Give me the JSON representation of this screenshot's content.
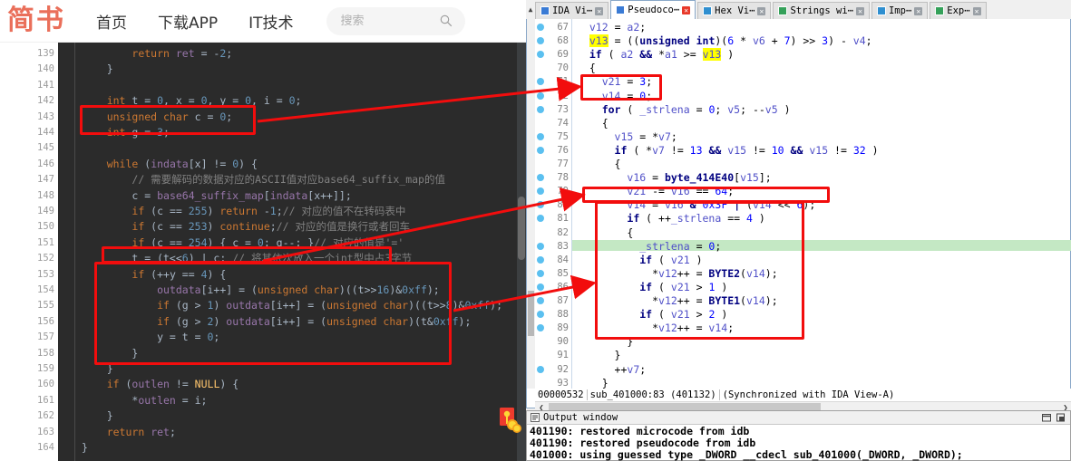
{
  "site": {
    "logo": "简书",
    "nav": [
      "首页",
      "下载APP",
      "IT技术"
    ],
    "search_placeholder": "搜索",
    "search_value": "",
    "search_icon": "search-icon",
    "envelope_icon": "red-envelope-icon"
  },
  "code": {
    "language": "c",
    "first_line": 139,
    "lines": [
      {
        "n": 139,
        "t": "        return ret = -2;"
      },
      {
        "n": 140,
        "t": "    }"
      },
      {
        "n": 141,
        "t": ""
      },
      {
        "n": 142,
        "t": "    int t = 0, x = 0, y = 0, i = 0;"
      },
      {
        "n": 143,
        "t": "    unsigned char c = 0;"
      },
      {
        "n": 144,
        "t": "    int g = 3;"
      },
      {
        "n": 145,
        "t": ""
      },
      {
        "n": 146,
        "t": "    while (indata[x] != 0) {"
      },
      {
        "n": 147,
        "t": "        // 需要解码的数据对应的ASCII值对应base64_suffix_map的值"
      },
      {
        "n": 148,
        "t": "        c = base64_suffix_map[indata[x++]];"
      },
      {
        "n": 149,
        "t": "        if (c == 255) return -1;// 对应的值不在转码表中"
      },
      {
        "n": 150,
        "t": "        if (c == 253) continue;// 对应的值是换行或者回车"
      },
      {
        "n": 151,
        "t": "        if (c == 254) { c = 0; g--; }// 对应的值是'='"
      },
      {
        "n": 152,
        "t": "        t = (t<<6) | c; // 将其依次放入一个int型中占3字节"
      },
      {
        "n": 153,
        "t": "        if (++y == 4) {"
      },
      {
        "n": 154,
        "t": "            outdata[i++] = (unsigned char)((t>>16)&0xff);"
      },
      {
        "n": 155,
        "t": "            if (g > 1) outdata[i++] = (unsigned char)((t>>8)&0xff);"
      },
      {
        "n": 156,
        "t": "            if (g > 2) outdata[i++] = (unsigned char)(t&0xff);"
      },
      {
        "n": 157,
        "t": "            y = t = 0;"
      },
      {
        "n": 158,
        "t": "        }"
      },
      {
        "n": 159,
        "t": "    }"
      },
      {
        "n": 160,
        "t": "    if (outlen != NULL) {"
      },
      {
        "n": 161,
        "t": "        *outlen = i;"
      },
      {
        "n": 162,
        "t": "    }"
      },
      {
        "n": 163,
        "t": "    return ret;"
      },
      {
        "n": 164,
        "t": "}"
      }
    ],
    "highlight_boxes": [
      {
        "name": "decl-box",
        "lines": "143-144"
      },
      {
        "name": "shift-box",
        "line": "152"
      },
      {
        "name": "output-box",
        "lines": "153-158"
      }
    ]
  },
  "ida": {
    "tabs": [
      {
        "label": "IDA Vi⋯",
        "active": false,
        "icon": "ida-view-icon",
        "close": "close-icon"
      },
      {
        "label": "Pseudoco⋯",
        "active": true,
        "icon": "pseudocode-icon",
        "close": "close-icon"
      },
      {
        "label": "Hex Vi⋯",
        "active": false,
        "icon": "hex-view-icon",
        "close": "close-icon"
      },
      {
        "label": "Strings wi⋯",
        "active": false,
        "icon": "strings-icon",
        "close": "close-icon"
      },
      {
        "label": "Imp⋯",
        "active": false,
        "icon": "imports-icon",
        "close": "close-icon"
      },
      {
        "label": "Exp⋯",
        "active": false,
        "icon": "exports-icon",
        "close": "close-icon"
      }
    ],
    "pseudocode": [
      {
        "n": 67,
        "dot": true,
        "t": "  v12 = a2;"
      },
      {
        "n": 68,
        "dot": true,
        "t": "  v13 = ((unsigned int)(6 * v6 + 7) >> 3) - v4;"
      },
      {
        "n": 69,
        "dot": true,
        "t": "  if ( a2 && *a1 >= v13 )"
      },
      {
        "n": 70,
        "dot": false,
        "t": "  {"
      },
      {
        "n": 71,
        "dot": true,
        "t": "    v21 = 3;"
      },
      {
        "n": 72,
        "dot": true,
        "t": "    v14 = 0;"
      },
      {
        "n": 73,
        "dot": true,
        "t": "    for ( _strlena = 0; v5; --v5 )"
      },
      {
        "n": 74,
        "dot": false,
        "t": "    {"
      },
      {
        "n": 75,
        "dot": true,
        "t": "      v15 = *v7;"
      },
      {
        "n": 76,
        "dot": true,
        "t": "      if ( *v7 != 13 && v15 != 10 && v15 != 32 )"
      },
      {
        "n": 77,
        "dot": false,
        "t": "      {"
      },
      {
        "n": 78,
        "dot": true,
        "t": "        v16 = byte_414E40[v15];"
      },
      {
        "n": 79,
        "dot": true,
        "t": "        v21 -= v16 == 64;"
      },
      {
        "n": 80,
        "dot": true,
        "t": "        v14 = v16 & 0x3F | (v14 << 6);"
      },
      {
        "n": 81,
        "dot": true,
        "t": "        if ( ++_strlena == 4 )"
      },
      {
        "n": 82,
        "dot": false,
        "t": "        {"
      },
      {
        "n": 83,
        "dot": true,
        "t": "          _strlena = 0;",
        "green": true
      },
      {
        "n": 84,
        "dot": true,
        "t": "          if ( v21 )"
      },
      {
        "n": 85,
        "dot": true,
        "t": "            *v12++ = BYTE2(v14);"
      },
      {
        "n": 86,
        "dot": true,
        "t": "          if ( v21 > 1 )"
      },
      {
        "n": 87,
        "dot": true,
        "t": "            *v12++ = BYTE1(v14);"
      },
      {
        "n": 88,
        "dot": true,
        "t": "          if ( v21 > 2 )"
      },
      {
        "n": 89,
        "dot": true,
        "t": "            *v12++ = v14;"
      },
      {
        "n": 90,
        "dot": false,
        "t": "        }"
      },
      {
        "n": 91,
        "dot": false,
        "t": "      }"
      },
      {
        "n": 92,
        "dot": true,
        "t": "      ++v7;"
      },
      {
        "n": 93,
        "dot": false,
        "t": "    }"
      }
    ],
    "highlighted_token": "v13",
    "status": {
      "offset": "00000532",
      "location": "sub_401000:83 (401132)",
      "sync": "(Synchronized with IDA View-A)"
    },
    "highlight_boxes": [
      {
        "name": "v21-init-box",
        "lines": "71-72"
      },
      {
        "name": "v14-mask-box",
        "line": "80"
      },
      {
        "name": "byte-emit-box",
        "lines": "81-90"
      }
    ],
    "output_window": {
      "title": "Output window",
      "restore_icon": "restore-icon",
      "dock_icon": "dock-icon",
      "lines": [
        "401190: restored microcode from idb",
        "401190: restored pseudocode from idb",
        "401000: using guessed type _DWORD __cdecl sub_401000(_DWORD, _DWORD);"
      ]
    },
    "hscroll": {
      "left_arrow": "chevron-left-icon",
      "right_arrow": "chevron-right-icon"
    }
  },
  "annotations": {
    "arrow_color": "#f20d0d",
    "arrows": [
      {
        "name": "arrow-decl-to-v21",
        "from": "code-line-143",
        "to": "ida-line-71"
      },
      {
        "name": "arrow-shift-to-mask",
        "from": "code-line-152",
        "to": "ida-line-80"
      },
      {
        "name": "arrow-output-to-emit",
        "from": "code-line-155",
        "to": "ida-line-86"
      }
    ]
  }
}
